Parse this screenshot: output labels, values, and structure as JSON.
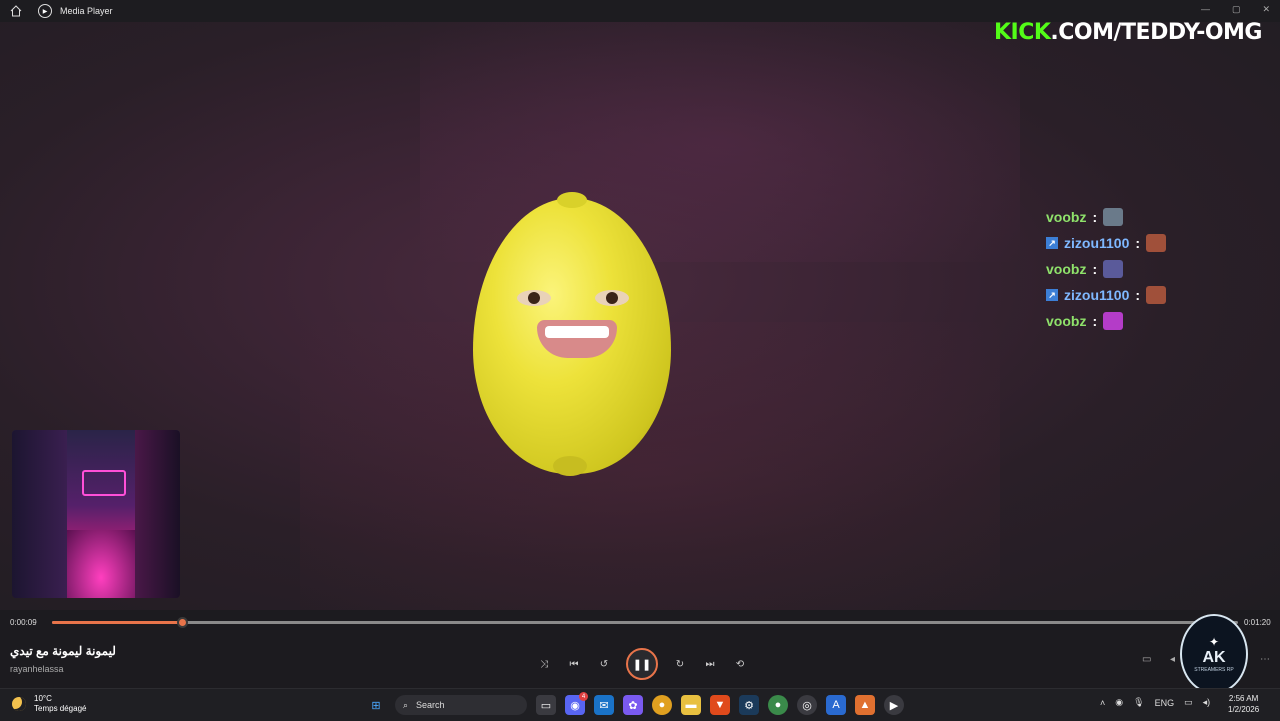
{
  "window": {
    "title": "Media Player"
  },
  "overlay": {
    "kick_brand": "KICK",
    "kick_rest": ".COM/TEDDY-OMG"
  },
  "chat": [
    {
      "user": "voobz",
      "badge": false,
      "emote_color": "#6a7a8a"
    },
    {
      "user": "zizou1100",
      "badge": true,
      "emote_color": "#a0503a"
    },
    {
      "user": "voobz",
      "badge": false,
      "emote_color": "#5a5a9a"
    },
    {
      "user": "zizou1100",
      "badge": true,
      "emote_color": "#a0503a"
    },
    {
      "user": "voobz",
      "badge": false,
      "emote_color": "#b43cc8"
    }
  ],
  "player": {
    "elapsed": "0:00:09",
    "duration": "0:01:20",
    "progress": 0.11,
    "song_title": "ليمونة ليمونة مع تيدي",
    "artist": "rayanhelassa",
    "accent_color": "#e8744a"
  },
  "badge": {
    "label": "AK",
    "sub": "STREAMERS RP"
  },
  "taskbar": {
    "temperature": "10°C",
    "weather": "Temps dégagé",
    "search_label": "Search",
    "language": "ENG",
    "time": "2:56 AM",
    "date": "1/2/2026",
    "notification_count": "4"
  }
}
